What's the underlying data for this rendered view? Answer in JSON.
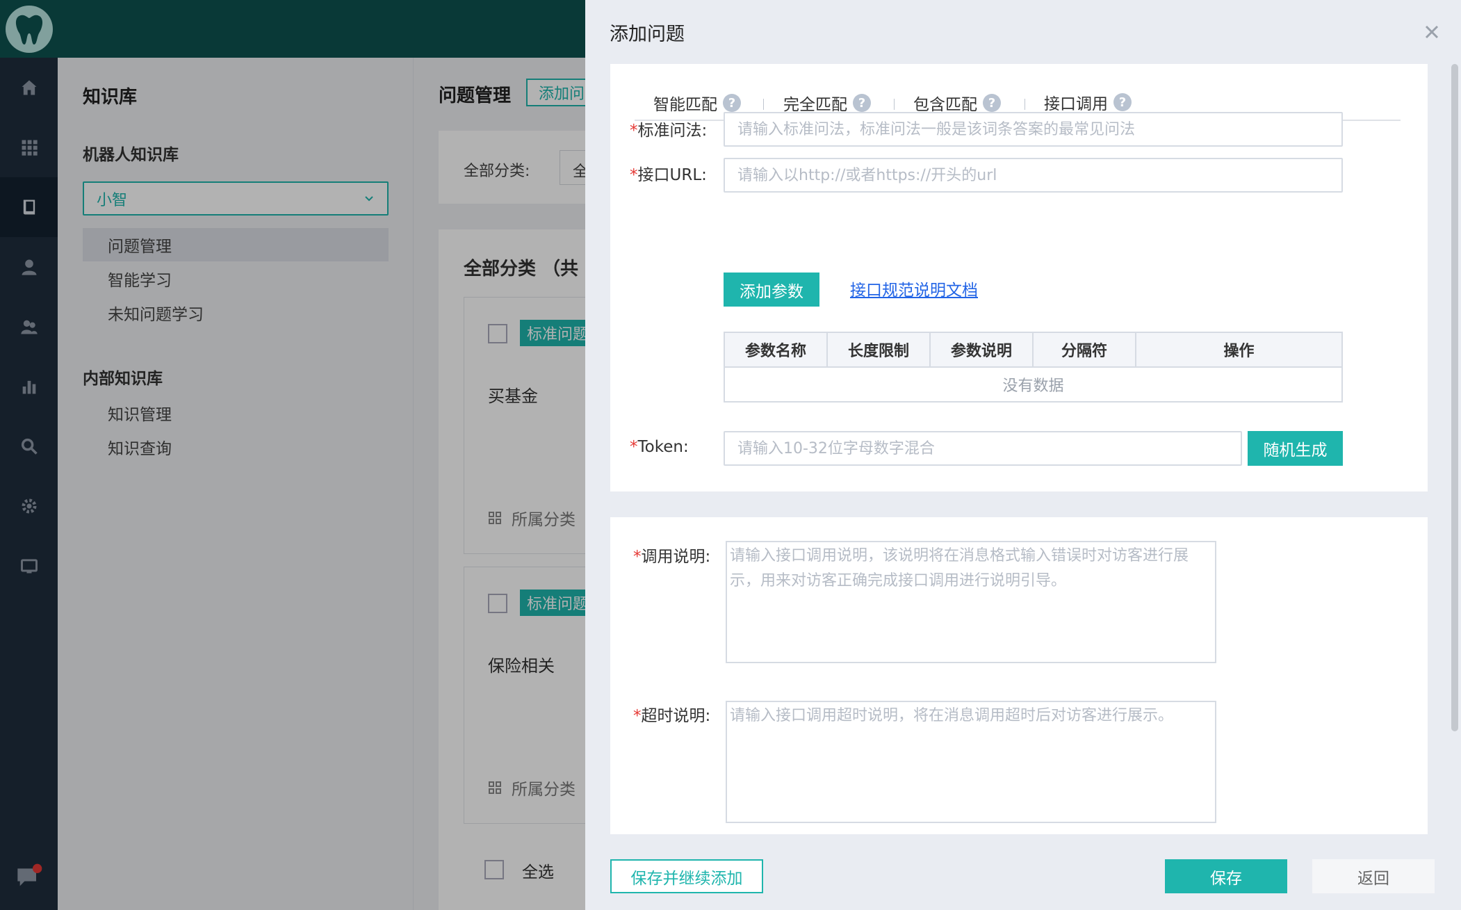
{
  "sidebar": {
    "title": "知识库",
    "robot_section": "机器人知识库",
    "robot_select": "小智",
    "robot_items": [
      "问题管理",
      "智能学习",
      "未知问题学习"
    ],
    "internal_section": "内部知识库",
    "internal_items": [
      "知识管理",
      "知识查询"
    ]
  },
  "main": {
    "title": "问题管理",
    "add_button": "添加问",
    "filter_label": "全部分类:",
    "filter_value": "全",
    "list_heading": "全部分类 （共",
    "cards": [
      {
        "badge": "标准问题",
        "question": "买基金",
        "category_label": "所属分类"
      },
      {
        "badge": "标准问题",
        "question": "保险相关",
        "category_label": "所属分类"
      }
    ],
    "select_all": "全选"
  },
  "drawer": {
    "title": "添加问题",
    "tabs": [
      "智能匹配",
      "完全匹配",
      "包含匹配",
      "接口调用"
    ],
    "active_tab": "接口调用",
    "std_question": {
      "label": "标准问法:",
      "placeholder": "请输入标准问法，标准问法一般是该词条答案的最常见问法"
    },
    "url": {
      "label": "接口URL:",
      "placeholder": "请输入以http://或者https://开头的url"
    },
    "add_param_button": "添加参数",
    "doc_link": "接口规范说明文档",
    "param_table": {
      "headers": [
        "参数名称",
        "长度限制",
        "参数说明",
        "分隔符",
        "操作"
      ],
      "empty_text": "没有数据"
    },
    "token": {
      "label": "Token:",
      "placeholder": "请输入10-32位字母数字混合",
      "random_button": "随机生成"
    },
    "call_desc": {
      "label": "调用说明:",
      "placeholder": "请输入接口调用说明，该说明将在消息格式输入错误时对访客进行展示，用来对访客正确完成接口调用进行说明引导。"
    },
    "timeout_desc": {
      "label": "超时说明:",
      "placeholder": "请输入接口调用超时说明，将在消息调用超时后对访客进行展示。"
    },
    "footer": {
      "save_continue": "保存并继续添加",
      "save": "保存",
      "back": "返回"
    }
  },
  "colors": {
    "accent": "#1fb5ad",
    "topbar": "#0d5250",
    "rail": "#1f2d3d",
    "link": "#2264e6",
    "required": "#e53935"
  },
  "icons": [
    "tooth-logo-icon",
    "home-icon",
    "apps-grid-icon",
    "book-icon",
    "user-icon",
    "users-icon",
    "bar-chart-icon",
    "search-icon",
    "gear-icon",
    "monitor-icon",
    "chat-icon",
    "chevron-down-icon",
    "help-icon",
    "close-icon",
    "grid-icon"
  ]
}
